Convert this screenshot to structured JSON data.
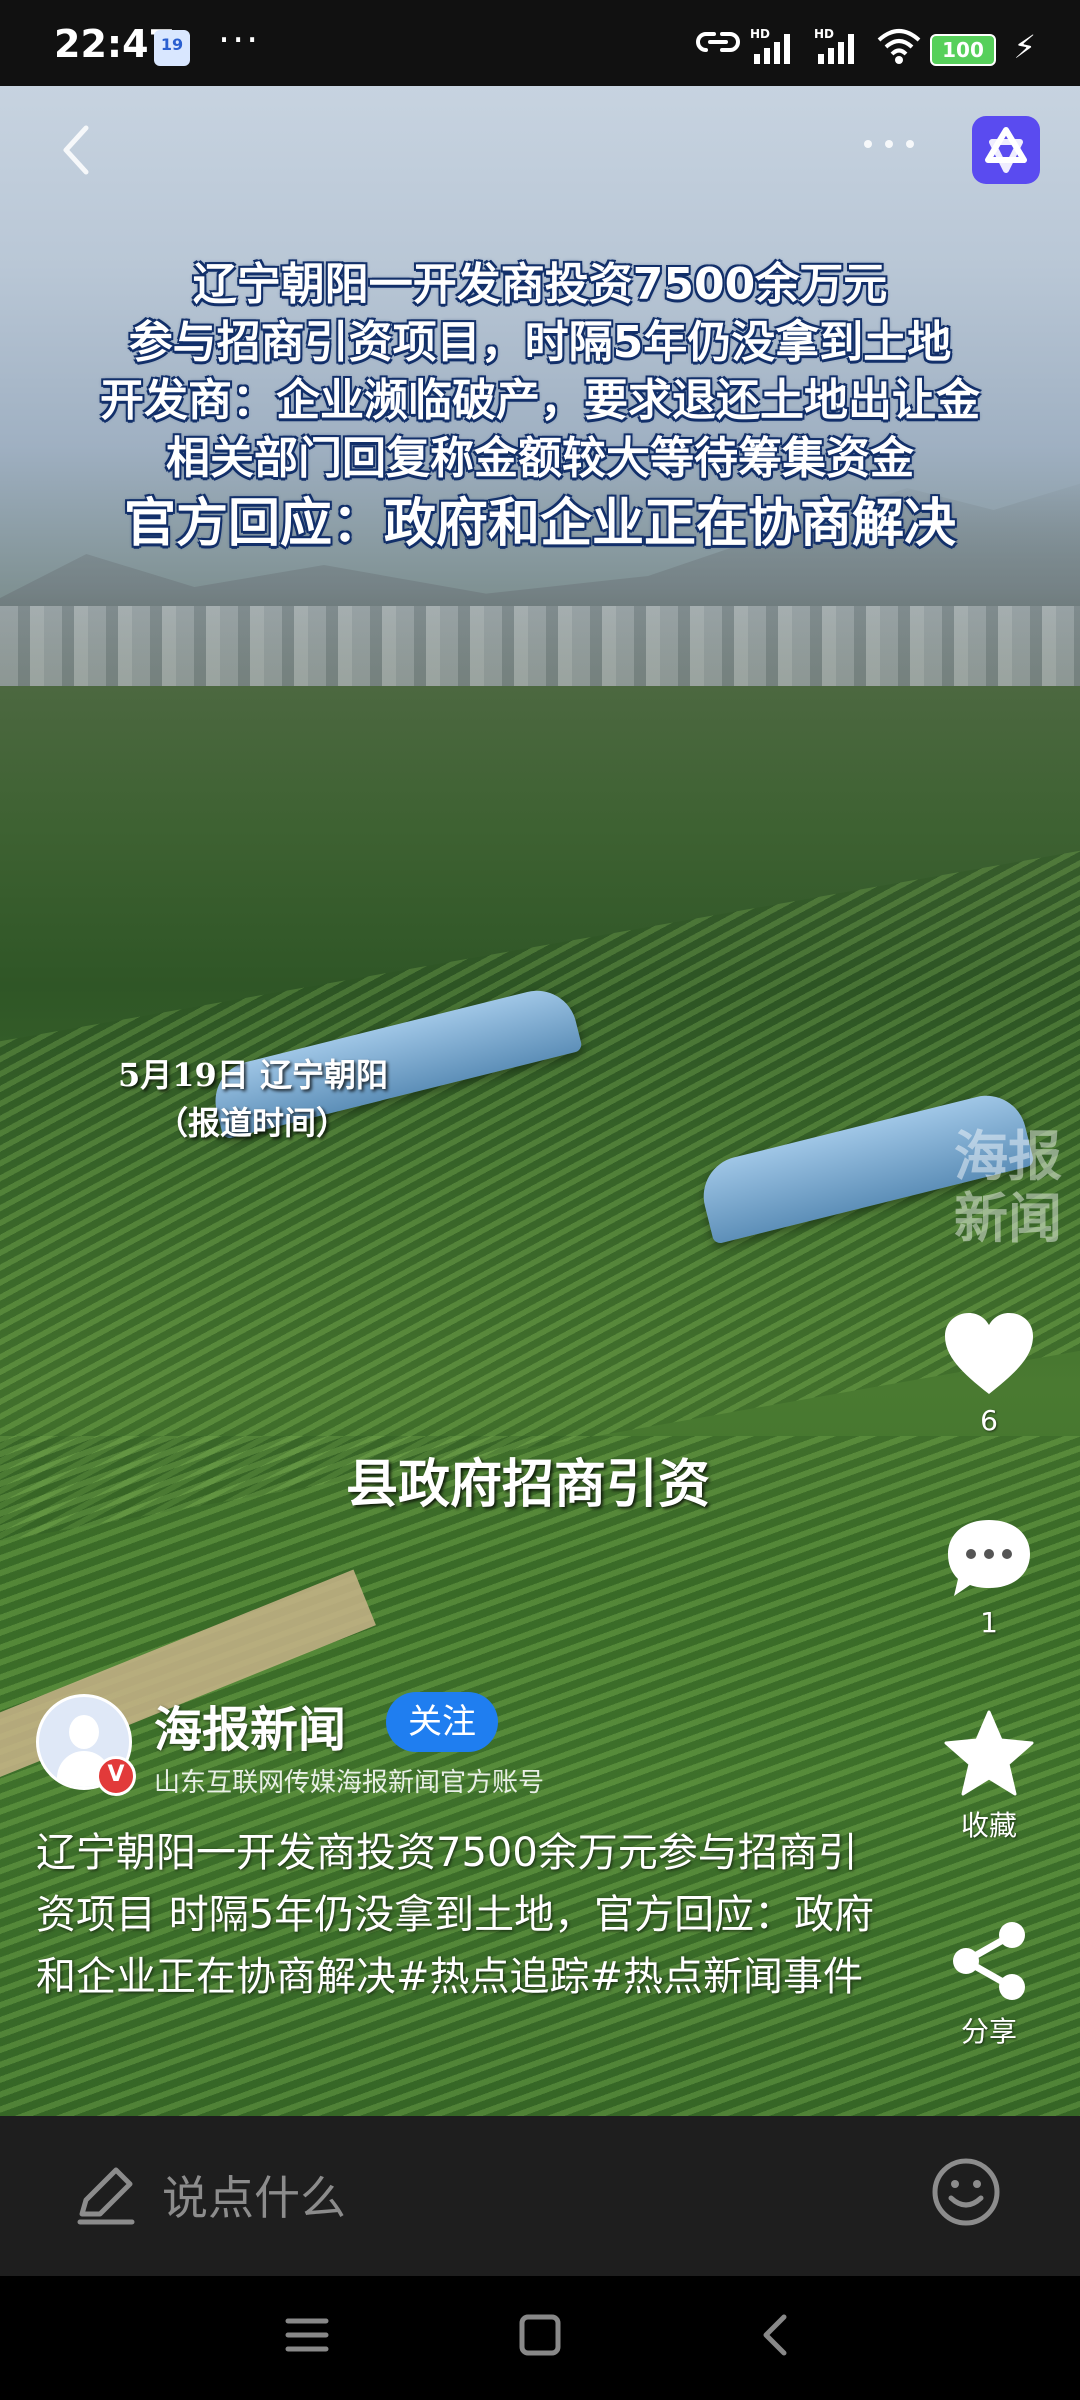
{
  "status_bar": {
    "time": "22:47",
    "calendar_day": "19",
    "overflow": "···",
    "battery": "100"
  },
  "video": {
    "headline": [
      "辽宁朝阳一开发商投资7500余万元",
      "参与招商引资项目，时隔5年仍没拿到土地",
      "开发商：企业濒临破产，要求退还土地出让金",
      "相关部门回复称金额较大等待筹集资金",
      "官方回应：政府和企业正在协商解决"
    ],
    "date_caption": "5月19日 辽宁朝阳",
    "date_caption_sub": "（报道时间）",
    "subtitle": "县政府招商引资",
    "watermark_line1": "海报",
    "watermark_line2": "新闻"
  },
  "top_bar": {
    "back_icon": "chevron-left-icon",
    "more_icon": "more-dots-icon"
  },
  "actions": {
    "like_count": "6",
    "comment_count": "1",
    "favorite_label": "收藏",
    "share_label": "分享"
  },
  "author": {
    "name": "海报新闻",
    "follow_label": "关注",
    "subtitle": "山东互联网传媒海报新闻官方账号",
    "verified_mark": "V"
  },
  "post": {
    "description": "辽宁朝阳一开发商投资7500余万元参与招商引资项目 时隔5年仍没拿到土地，官方回应：政府和企业正在协商解决#热点追踪#热点新闻事件"
  },
  "comment_bar": {
    "placeholder": "说点什么"
  },
  "colors": {
    "follow_button": "#1f7ef0",
    "app_logo": "#5a4bf0",
    "verified_badge": "#e23a3a"
  }
}
